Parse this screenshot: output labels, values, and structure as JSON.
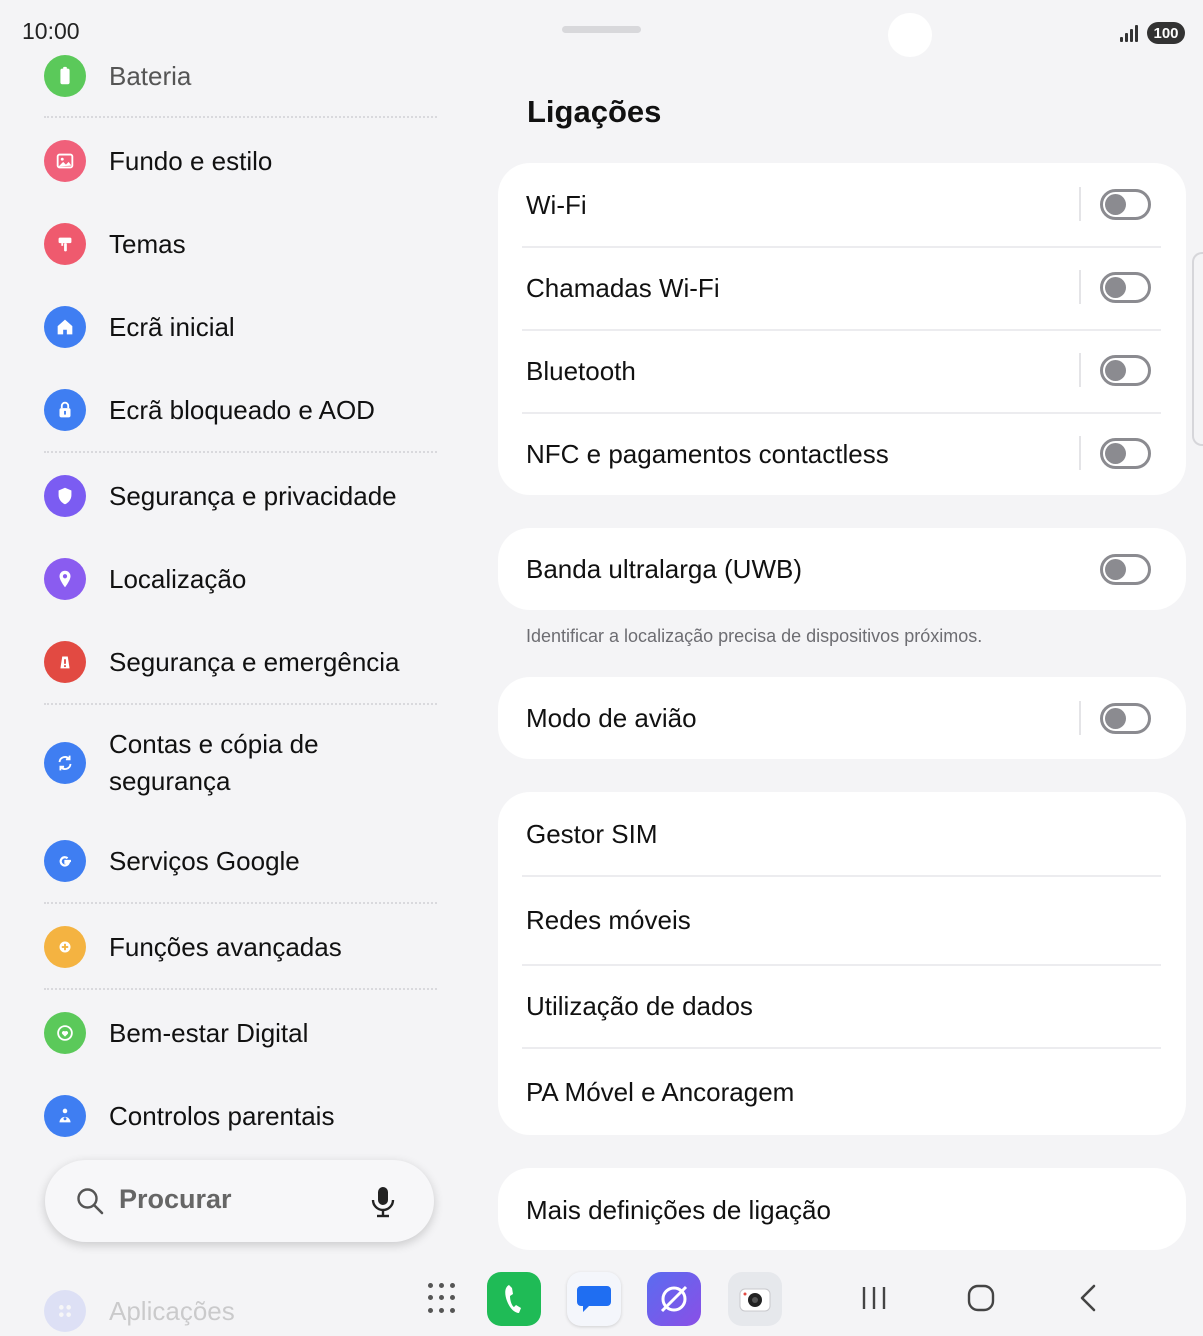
{
  "status_bar": {
    "time": "10:00",
    "battery": "100"
  },
  "sidebar": {
    "items": [
      {
        "label": "Bateria",
        "color": "#5bc95a"
      },
      {
        "label": "Fundo e estilo",
        "color": "#f0607a"
      },
      {
        "label": "Temas",
        "color": "#ef5a6e"
      },
      {
        "label": "Ecrã inicial",
        "color": "#3f7ef2"
      },
      {
        "label": "Ecrã bloqueado e AOD",
        "color": "#3f7ef2"
      },
      {
        "label": "Segurança e privacidade",
        "color": "#7b5cf2"
      },
      {
        "label": "Localização",
        "color": "#8a5cf0"
      },
      {
        "label": "Segurança e emergência",
        "color": "#e24a42"
      },
      {
        "label_line1": "Contas e cópia de",
        "label_line2": "segurança",
        "color": "#3f7ef2"
      },
      {
        "label": "Serviços Google",
        "color": "#3f7ef2"
      },
      {
        "label": "Funções avançadas",
        "color": "#f4b341"
      },
      {
        "label": "Bem-estar Digital",
        "color": "#5bc95a"
      },
      {
        "label": "Controlos parentais",
        "color": "#3f7ef2"
      },
      {
        "label": "Aplicações",
        "color": "#7b8cf2"
      }
    ]
  },
  "search": {
    "placeholder": "Procurar"
  },
  "main": {
    "title": "Ligações",
    "group1": [
      {
        "label": "Wi-Fi",
        "enabled": false
      },
      {
        "label": "Chamadas Wi-Fi",
        "enabled": false
      },
      {
        "label": "Bluetooth",
        "enabled": false
      },
      {
        "label": "NFC e pagamentos contactless",
        "enabled": false
      }
    ],
    "uwb": {
      "label": "Banda ultralarga (UWB)",
      "enabled": false,
      "hint": "Identificar a localização precisa de dispositivos próximos."
    },
    "airplane": {
      "label": "Modo de avião",
      "enabled": false
    },
    "group3": [
      {
        "label": "Gestor SIM"
      },
      {
        "label": "Redes móveis"
      },
      {
        "label": "Utilização de dados"
      },
      {
        "label": "PA Móvel e Ancoragem"
      }
    ],
    "more": {
      "label": "Mais definições de ligação"
    }
  },
  "taskbar": {
    "apps": [
      "phone-icon",
      "messages-icon",
      "internet-icon",
      "camera-icon"
    ],
    "nav": [
      "recents-icon",
      "home-icon",
      "back-icon"
    ]
  }
}
